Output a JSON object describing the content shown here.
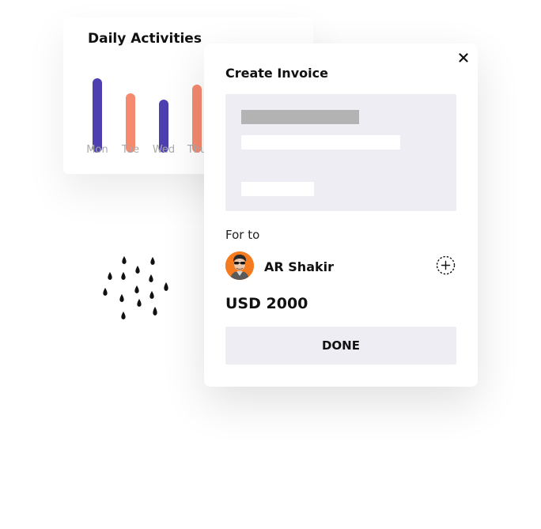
{
  "activity_card": {
    "title": "Daily Activities"
  },
  "chart_data": {
    "type": "bar",
    "title": "Daily Activities",
    "categories": [
      "Mon",
      "Tue",
      "Wed",
      "Thu"
    ],
    "values": [
      94,
      75,
      67,
      86
    ],
    "colors": [
      "#4e3fb1",
      "#f68a6f",
      "#4e3fb1",
      "#f68a6f"
    ],
    "ylim": [
      0,
      100
    ],
    "grid": false,
    "xlabel": "",
    "ylabel": ""
  },
  "invoice": {
    "title": "Create Invoice",
    "for_label": "For to",
    "customer_name": "AR Shakir",
    "amount": "USD 2000",
    "done_label": "DONE",
    "close_icon": "close-icon",
    "add_icon": "add-circle-icon"
  },
  "colors": {
    "accent_purple": "#4e3fb1",
    "accent_coral": "#f68a6f",
    "panel_grey": "#eeedf4",
    "avatar_orange": "#f57b1e"
  }
}
